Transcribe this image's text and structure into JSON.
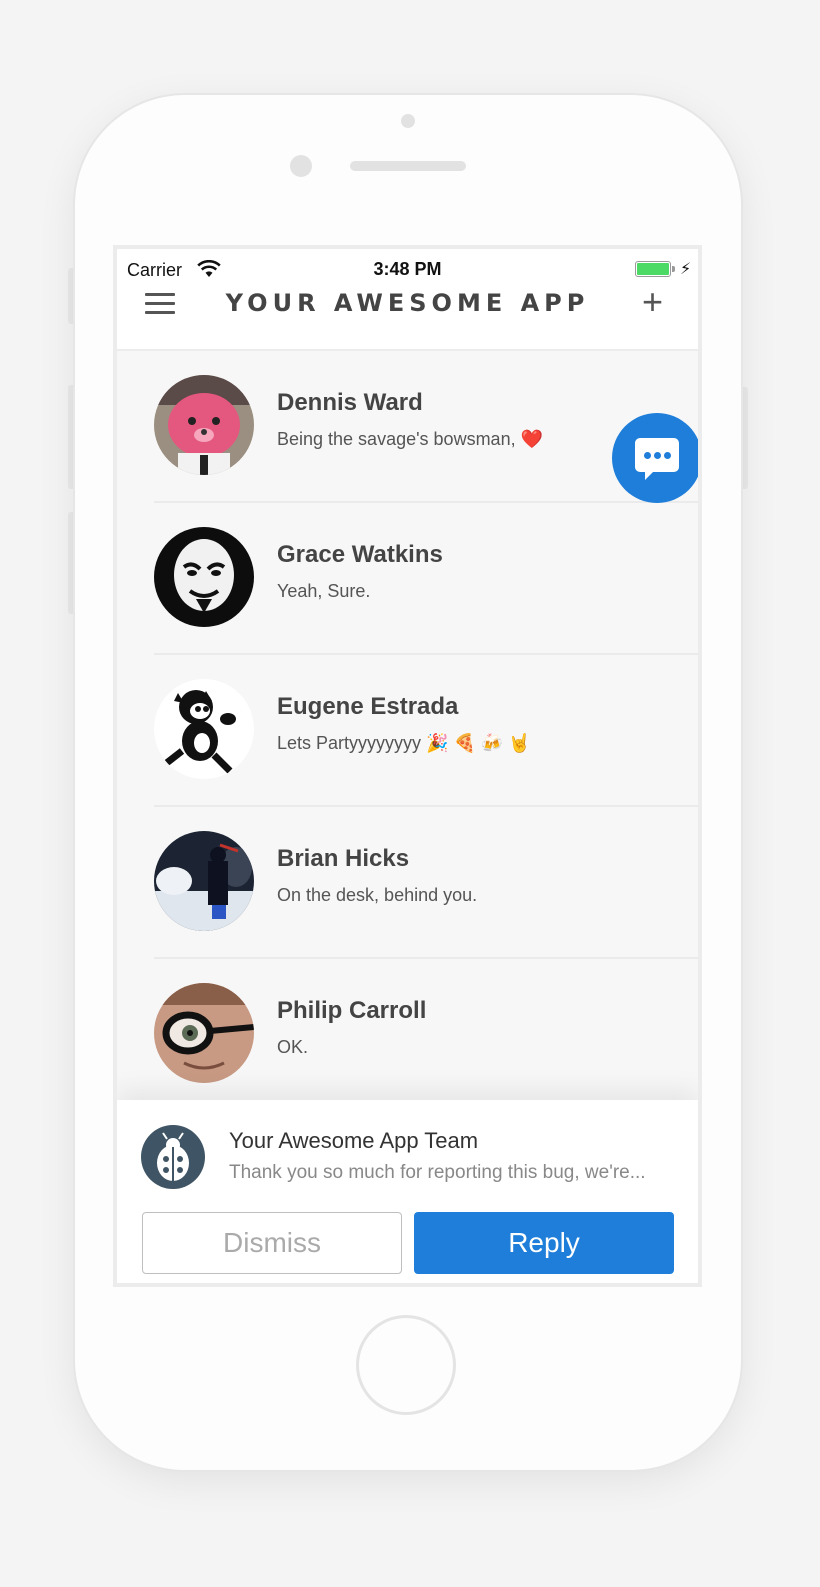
{
  "status_bar": {
    "carrier": "Carrier",
    "time": "3:48 PM"
  },
  "nav": {
    "title": "YOUR AWESOME APP"
  },
  "conversations": [
    {
      "name": "Dennis Ward",
      "message": "Being the savage's bowsman, ❤️",
      "avatar": "pink-bear-avatar"
    },
    {
      "name": "Grace Watkins",
      "message": "Yeah, Sure.",
      "avatar": "mask-avatar"
    },
    {
      "name": "Eugene Estrada",
      "message": "Lets Partyyyyyyyy 🎉 🍕 🍻 🤘",
      "avatar": "cartoon-cat-avatar"
    },
    {
      "name": "Brian Hicks",
      "message": "On the desk, behind you.",
      "avatar": "snow-avatar"
    },
    {
      "name": "Philip Carroll",
      "message": "OK.",
      "avatar": "glasses-avatar"
    }
  ],
  "notification": {
    "title": "Your Awesome App Team",
    "body": "Thank you so much for reporting this bug, we're...",
    "dismiss_label": "Dismiss",
    "reply_label": "Reply",
    "icon": "ladybug-icon"
  },
  "colors": {
    "accent": "#1e7ed9",
    "battery": "#4cd964",
    "text_primary": "#444444"
  }
}
